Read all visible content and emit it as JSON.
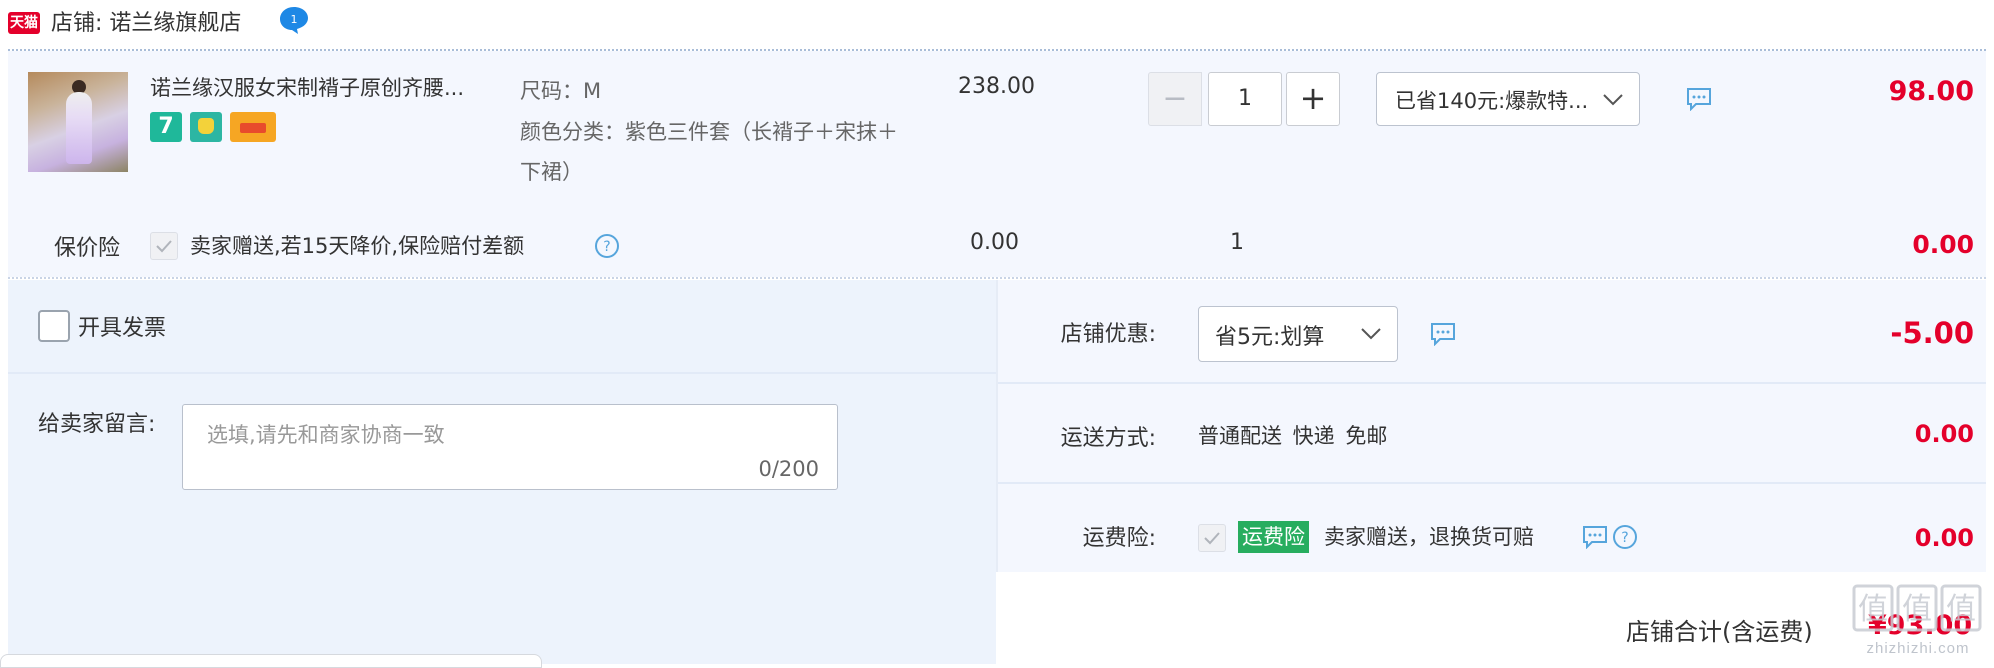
{
  "shop": {
    "tmall_badge": "天猫",
    "label": "店铺: 诺兰缘旗舰店",
    "name": "诺兰缘旗舰店",
    "wangwang_count": "1"
  },
  "item": {
    "title": "诺兰缘汉服女宋制褙子原创齐腰...",
    "badge_seven": "7",
    "size_line": "尺码：M",
    "color_line": "颜色分类：紫色三件套（长褙子＋宋抹＋下裙）",
    "unit_price": "238.00",
    "quantity": "1",
    "qty_minus": "−",
    "qty_plus": "+",
    "promo_selected": "已省140元:爆款特...",
    "row_total": "98.00"
  },
  "price_insurance": {
    "label": "保价险",
    "desc": "卖家赠送,若15天降价,保险赔付差额",
    "price": "0.00",
    "qty": "1",
    "total": "0.00"
  },
  "invoice": {
    "label": "开具发票"
  },
  "memo": {
    "label": "给卖家留言:",
    "placeholder": "选填,请先和商家协商一致",
    "counter": "0/200"
  },
  "shop_coupon": {
    "label": "店铺优惠:",
    "selected": "省5元:划算",
    "value": "-5.00"
  },
  "shipping": {
    "label": "运送方式:",
    "text": "普通配送 快递 免邮",
    "value": "0.00"
  },
  "freight_insurance": {
    "label": "运费险:",
    "tag": "运费险",
    "desc": "卖家赠送，退换货可赔",
    "value": "0.00"
  },
  "shop_total": {
    "label": "店铺合计(含运费)",
    "value": "¥93.00"
  },
  "watermark": {
    "logo_text": "值",
    "site": "zhizhizhi.com"
  },
  "colors": {
    "accent_red": "#e4002b",
    "panel_bg": "#f4f7fe",
    "panel_bg_alt": "#edf3fc",
    "freight_green": "#27ad5f",
    "icon_blue": "#56a5dc"
  }
}
